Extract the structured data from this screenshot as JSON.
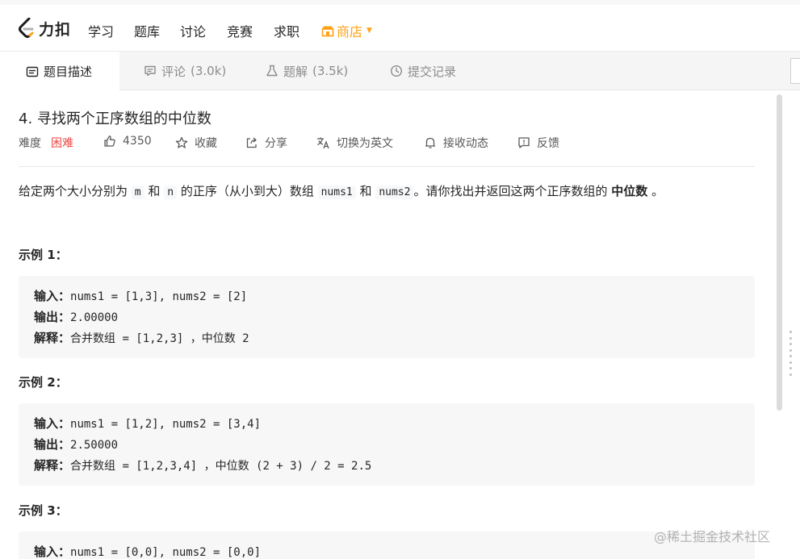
{
  "brand": {
    "logo_text": "力扣"
  },
  "nav": {
    "items": [
      "学习",
      "题库",
      "讨论",
      "竞赛",
      "求职"
    ],
    "store": "商店"
  },
  "tabs": [
    {
      "label": "题目描述",
      "count": ""
    },
    {
      "label": "评论",
      "count": "(3.0k)"
    },
    {
      "label": "题解",
      "count": "(3.5k)"
    },
    {
      "label": "提交记录",
      "count": ""
    }
  ],
  "problem": {
    "title": "4. 寻找两个正序数组的中位数",
    "difficulty_label": "难度",
    "difficulty": "困难",
    "likes": "4350",
    "favorite": "收藏",
    "share": "分享",
    "switch_lang": "切换为英文",
    "notify": "接收动态",
    "feedback": "反馈",
    "description": {
      "t1": "给定两个大小分别为",
      "m": "m",
      "t2": "和",
      "n": "n",
      "t3": "的正序（从小到大）数组",
      "nums1": "nums1",
      "t4": "和",
      "nums2": "nums2",
      "t5": "。请你找出并返回这两个正序数组的",
      "bold": "中位数",
      "t6": "。"
    }
  },
  "examples": [
    {
      "title": "示例 1：",
      "input_label": "输入：",
      "input": "nums1 = [1,3], nums2 = [2]",
      "output_label": "输出：",
      "output": "2.00000",
      "explain_label": "解释：",
      "explain": "合并数组 = [1,2,3] ，中位数 2"
    },
    {
      "title": "示例 2：",
      "input_label": "输入：",
      "input": "nums1 = [1,2], nums2 = [3,4]",
      "output_label": "输出：",
      "output": "2.50000",
      "explain_label": "解释：",
      "explain": "合并数组 = [1,2,3,4] ，中位数 (2 + 3) / 2 = 2.5"
    },
    {
      "title": "示例 3：",
      "input_label": "输入：",
      "input": "nums1 = [0,0], nums2 = [0,0]"
    }
  ],
  "watermark": "@稀土掘金技术社区",
  "colors": {
    "accent": "#ffa116",
    "hard": "#ef4743",
    "code_bg": "#f7f7f8"
  }
}
